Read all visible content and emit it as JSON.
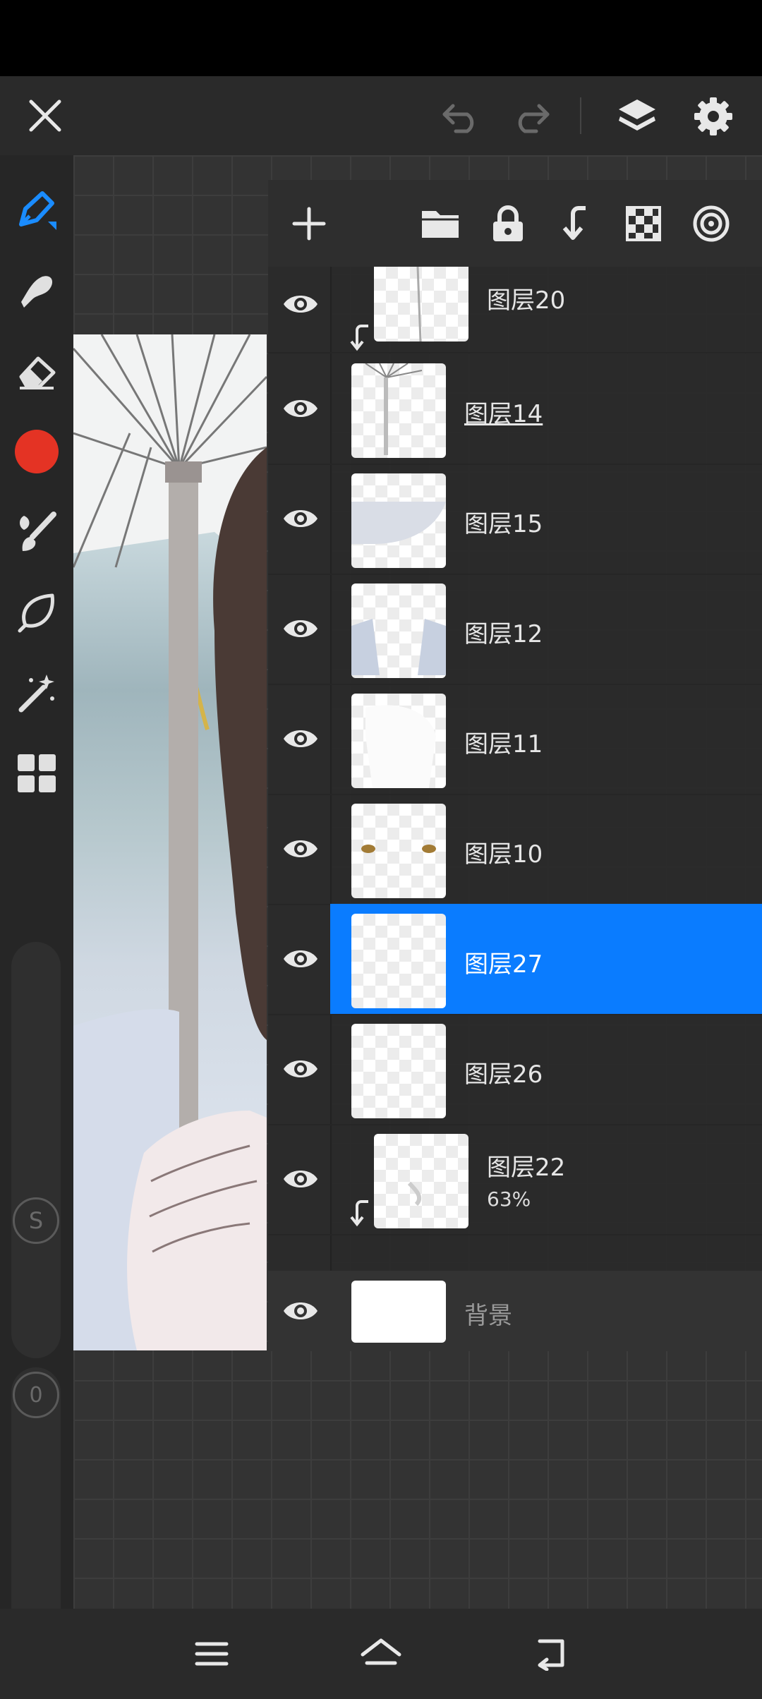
{
  "colors": {
    "accent": "#0a7cff",
    "brush_color": "#e43324"
  },
  "top_bar": {
    "close_icon": "close-icon",
    "undo_icon": "undo-icon",
    "redo_icon": "redo-icon",
    "layers_icon": "layers-icon",
    "settings_icon": "gear-icon"
  },
  "tools": [
    "pen-icon",
    "smudge-icon",
    "eraser-icon",
    "color-swatch",
    "brush-icon",
    "lasso-icon",
    "magic-wand-icon",
    "gallery-icon"
  ],
  "sliders": {
    "size_badge": "S",
    "opacity_badge": "0"
  },
  "layer_panel": {
    "toolbar": [
      "add-icon",
      "folder-icon",
      "lock-icon",
      "merge-down-icon",
      "transparency-icon",
      "target-icon"
    ],
    "layers": [
      {
        "name": "图层20",
        "clipped": true
      },
      {
        "name": "图层14",
        "underlined": true
      },
      {
        "name": "图层15"
      },
      {
        "name": "图层12"
      },
      {
        "name": "图层11"
      },
      {
        "name": "图层10"
      },
      {
        "name": "图层27",
        "selected": true
      },
      {
        "name": "图层26"
      },
      {
        "name": "图层22",
        "opacity": "63%",
        "clipped": true
      },
      {
        "name": "背景"
      }
    ]
  },
  "nav_bar": [
    "menu-icon",
    "home-icon",
    "back-icon"
  ]
}
